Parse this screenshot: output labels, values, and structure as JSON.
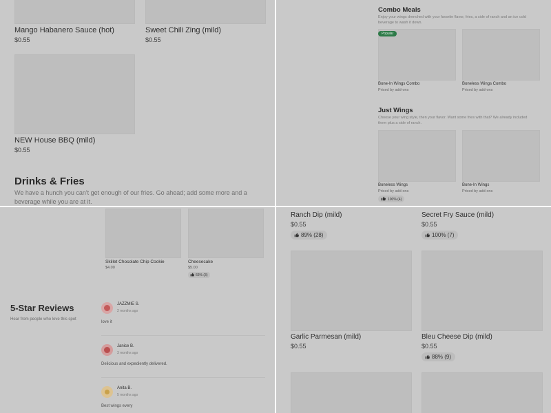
{
  "panel1": {
    "items": [
      {
        "name": "Mango Habanero Sauce (hot)",
        "price": "$0.55"
      },
      {
        "name": "Sweet Chili Zing (mild)",
        "price": "$0.55"
      },
      {
        "name": "NEW House BBQ (mild)",
        "price": "$0.55"
      }
    ],
    "section_title": "Drinks & Fries",
    "section_desc": "We have a hunch you can't get enough of our fries. Go ahead; add some more and a beverage while you are at it."
  },
  "panel2": {
    "combo_title": "Combo Meals",
    "combo_desc": "Enjoy your wings drenched with your favorite flavor, fries, a side of ranch and an ice cold beverage to wash it down.",
    "popular_badge": "Popular",
    "combo_items": [
      {
        "name": "Bone-In Wings Combo",
        "sub": "Priced by add-ons"
      },
      {
        "name": "Boneless Wings Combo",
        "sub": "Priced by add-ons"
      }
    ],
    "wings_title": "Just Wings",
    "wings_desc": "Choose your wing style, then your flavor. Want some fries with that? We already included them plus a side of ranch.",
    "wing_items": [
      {
        "name": "Boneless Wings",
        "sub": "Priced by add-ons",
        "rating": "100% (4)"
      },
      {
        "name": "Bone-In Wings",
        "sub": "Priced by add-ons"
      }
    ]
  },
  "panel3": {
    "desserts": [
      {
        "name": "Skillet Chocolate Chip Cookie",
        "price": "$4.00"
      },
      {
        "name": "Cheesecake",
        "price": "$5.00",
        "rating": "66% (3)"
      }
    ],
    "reviews_title": "5-Star Reviews",
    "reviews_subtitle": "Hear from people who love this spot",
    "reviews": [
      {
        "name": "JAZZMIE S.",
        "date": "2 months ago",
        "text": "love it",
        "color": "#c35a5a"
      },
      {
        "name": "Janice B.",
        "date": "3 months ago",
        "text": "Delicious and expediently delivered.",
        "color": "#b94f4f"
      },
      {
        "name": "Anita B.",
        "date": "5 months ago",
        "text": "Best wings every",
        "color": "#c9a14a"
      }
    ]
  },
  "panel4": {
    "items": [
      {
        "name": "Ranch Dip (mild)",
        "price": "$0.55",
        "rating": "89% (28)"
      },
      {
        "name": "Secret Fry Sauce (mild)",
        "price": "$0.55",
        "rating": "100% (7)"
      },
      {
        "name": "Garlic Parmesan (mild)",
        "price": "$0.55"
      },
      {
        "name": "Bleu Cheese Dip (mild)",
        "price": "$0.55",
        "rating": "88% (9)"
      }
    ]
  },
  "icons": {
    "rating": "thumbs-up-icon",
    "avatar": "user-avatar-icon"
  }
}
